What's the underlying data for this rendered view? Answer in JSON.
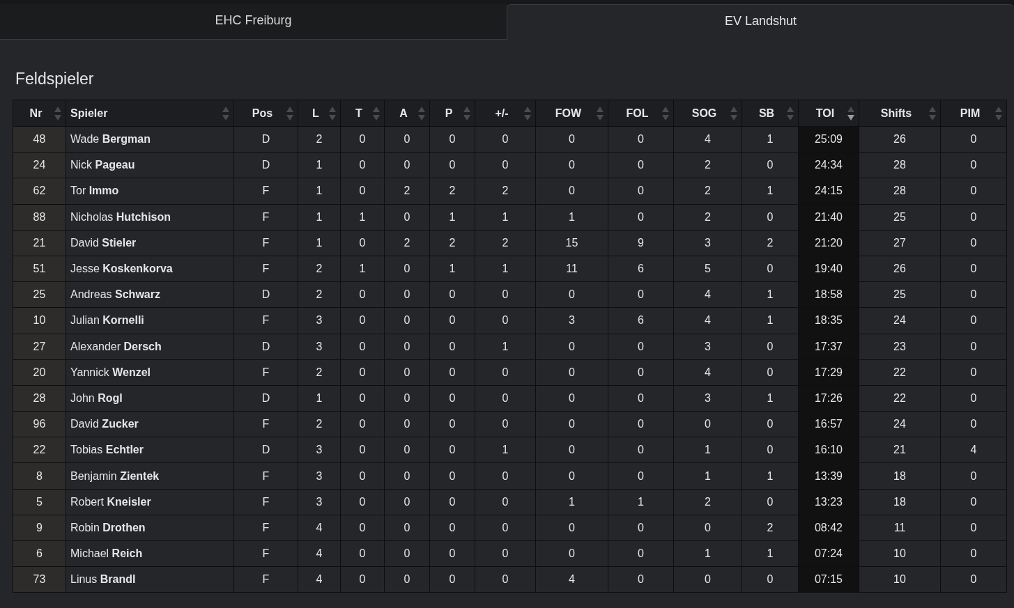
{
  "tabs": [
    {
      "label": "EHC Freiburg",
      "selected": false
    },
    {
      "label": "EV Landshut",
      "selected": true
    }
  ],
  "section_title": "Feldspieler",
  "table": {
    "columns": [
      {
        "label": "Nr",
        "sorted": false
      },
      {
        "label": "Spieler",
        "sorted": false
      },
      {
        "label": "Pos",
        "sorted": false
      },
      {
        "label": "L",
        "sorted": false
      },
      {
        "label": "T",
        "sorted": false
      },
      {
        "label": "A",
        "sorted": false
      },
      {
        "label": "P",
        "sorted": false
      },
      {
        "label": "+/-",
        "sorted": false
      },
      {
        "label": "FOW",
        "sorted": false
      },
      {
        "label": "FOL",
        "sorted": false
      },
      {
        "label": "SOG",
        "sorted": false
      },
      {
        "label": "SB",
        "sorted": false
      },
      {
        "label": "TOI",
        "sorted": true
      },
      {
        "label": "Shifts",
        "sorted": false
      },
      {
        "label": "PIM",
        "sorted": false
      }
    ],
    "rows": [
      [
        "48",
        "Wade **Bergman**",
        "D",
        "2",
        "0",
        "0",
        "0",
        "0",
        "0",
        "0",
        "4",
        "1",
        "25:09",
        "26",
        "0"
      ],
      [
        "24",
        "Nick **Pageau**",
        "D",
        "1",
        "0",
        "0",
        "0",
        "0",
        "0",
        "0",
        "2",
        "0",
        "24:34",
        "28",
        "0"
      ],
      [
        "62",
        "Tor **Immo**",
        "F",
        "1",
        "0",
        "2",
        "2",
        "2",
        "0",
        "0",
        "2",
        "1",
        "24:15",
        "28",
        "0"
      ],
      [
        "88",
        "Nicholas **Hutchison**",
        "F",
        "1",
        "1",
        "0",
        "1",
        "1",
        "1",
        "0",
        "2",
        "0",
        "21:40",
        "25",
        "0"
      ],
      [
        "21",
        "David **Stieler**",
        "F",
        "1",
        "0",
        "2",
        "2",
        "2",
        "15",
        "9",
        "3",
        "2",
        "21:20",
        "27",
        "0"
      ],
      [
        "51",
        "Jesse **Koskenkorva**",
        "F",
        "2",
        "1",
        "0",
        "1",
        "1",
        "11",
        "6",
        "5",
        "0",
        "19:40",
        "26",
        "0"
      ],
      [
        "25",
        "Andreas **Schwarz**",
        "D",
        "2",
        "0",
        "0",
        "0",
        "0",
        "0",
        "0",
        "4",
        "1",
        "18:58",
        "25",
        "0"
      ],
      [
        "10",
        "Julian **Kornelli**",
        "F",
        "3",
        "0",
        "0",
        "0",
        "0",
        "3",
        "6",
        "4",
        "1",
        "18:35",
        "24",
        "0"
      ],
      [
        "27",
        "Alexander **Dersch**",
        "D",
        "3",
        "0",
        "0",
        "0",
        "1",
        "0",
        "0",
        "3",
        "0",
        "17:37",
        "23",
        "0"
      ],
      [
        "20",
        "Yannick **Wenzel**",
        "F",
        "2",
        "0",
        "0",
        "0",
        "0",
        "0",
        "0",
        "4",
        "0",
        "17:29",
        "22",
        "0"
      ],
      [
        "28",
        "John **Rogl**",
        "D",
        "1",
        "0",
        "0",
        "0",
        "0",
        "0",
        "0",
        "3",
        "1",
        "17:26",
        "22",
        "0"
      ],
      [
        "96",
        "David **Zucker**",
        "F",
        "2",
        "0",
        "0",
        "0",
        "0",
        "0",
        "0",
        "0",
        "0",
        "16:57",
        "24",
        "0"
      ],
      [
        "22",
        "Tobias **Echtler**",
        "D",
        "3",
        "0",
        "0",
        "0",
        "1",
        "0",
        "0",
        "1",
        "0",
        "16:10",
        "21",
        "4"
      ],
      [
        "8",
        "Benjamin **Zientek**",
        "F",
        "3",
        "0",
        "0",
        "0",
        "0",
        "0",
        "0",
        "1",
        "1",
        "13:39",
        "18",
        "0"
      ],
      [
        "5",
        "Robert **Kneisler**",
        "F",
        "3",
        "0",
        "0",
        "0",
        "0",
        "1",
        "1",
        "2",
        "0",
        "13:23",
        "18",
        "0"
      ],
      [
        "9",
        "Robin **Drothen**",
        "F",
        "4",
        "0",
        "0",
        "0",
        "0",
        "0",
        "0",
        "0",
        "2",
        "08:42",
        "11",
        "0"
      ],
      [
        "6",
        "Michael **Reich**",
        "F",
        "4",
        "0",
        "0",
        "0",
        "0",
        "0",
        "0",
        "1",
        "1",
        "07:24",
        "10",
        "0"
      ],
      [
        "73",
        "Linus **Brandl**",
        "F",
        "4",
        "0",
        "0",
        "0",
        "0",
        "4",
        "0",
        "0",
        "0",
        "07:15",
        "10",
        "0"
      ]
    ]
  }
}
